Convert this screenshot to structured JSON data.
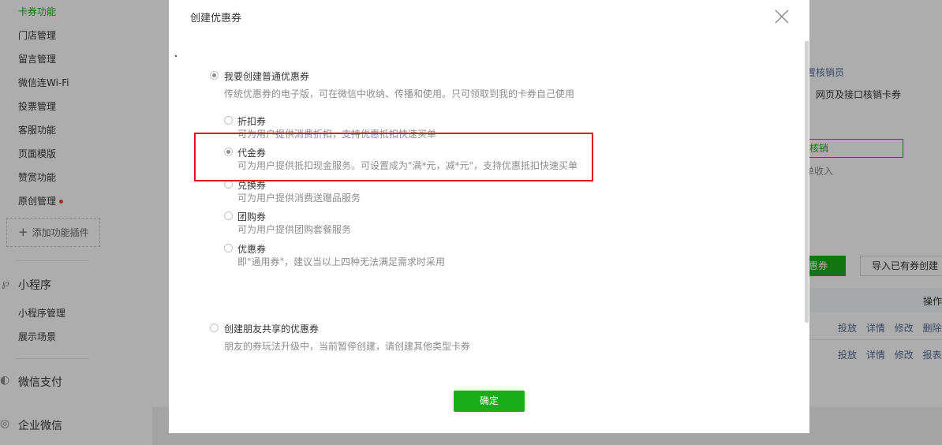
{
  "sidebar": {
    "items": [
      {
        "label": "卡券功能",
        "active": true
      },
      {
        "label": "门店管理"
      },
      {
        "label": "留言管理"
      },
      {
        "label": "微信连Wi-Fi"
      },
      {
        "label": "投票管理"
      },
      {
        "label": "客服功能"
      },
      {
        "label": "页面模版"
      },
      {
        "label": "赞赏功能"
      },
      {
        "label": "原创管理"
      }
    ],
    "add_plugin_label": "添加功能插件",
    "sections": [
      {
        "label": "小程序",
        "items": [
          "小程序管理",
          "展示场景"
        ]
      },
      {
        "label": "微信支付"
      },
      {
        "label": "企业微信"
      }
    ]
  },
  "background": {
    "verifier_label": "置核销员",
    "verify_desc": "，网页及接口核销卡券",
    "verify_button": "核销",
    "income_text": "单收入",
    "create_coupon_btn": "惠券",
    "import_btn": "导入已有券创建",
    "table_header": "操作",
    "row_ops": [
      [
        "投放",
        "详情",
        "修改",
        "删除"
      ],
      [
        "投放",
        "详情",
        "修改",
        "报表"
      ]
    ]
  },
  "modal": {
    "title": "创建优惠券",
    "general": {
      "label": "我要创建普通优惠券",
      "desc": "传统优惠券的电子版，可在微信中收纳、传播和使用。只可领取到我的卡券自己使用",
      "options": [
        {
          "label": "折扣券",
          "desc": "可为用户提供消费折扣，支持优惠抵扣快速买单"
        },
        {
          "label": "代金券",
          "desc": "可为用户提供抵扣现金服务。可设置成为\"满*元，减*元\"，支持优惠抵扣快速买单"
        },
        {
          "label": "兑换券",
          "desc": "可为用户提供消费送赠品服务"
        },
        {
          "label": "团购券",
          "desc": "可为用户提供团购套餐服务"
        },
        {
          "label": "优惠券",
          "desc": "即\"通用券\"，建议当以上四种无法满足需求时采用"
        }
      ]
    },
    "shared": {
      "label": "创建朋友共享的优惠券",
      "desc": "朋友的券玩法升级中，当前暂停创建，请创建其他类型卡券"
    },
    "confirm_label": "确定"
  },
  "colors": {
    "accent": "#1aad19",
    "highlight": "#e0161b",
    "link": "#576b95",
    "dot": "#e64340"
  }
}
